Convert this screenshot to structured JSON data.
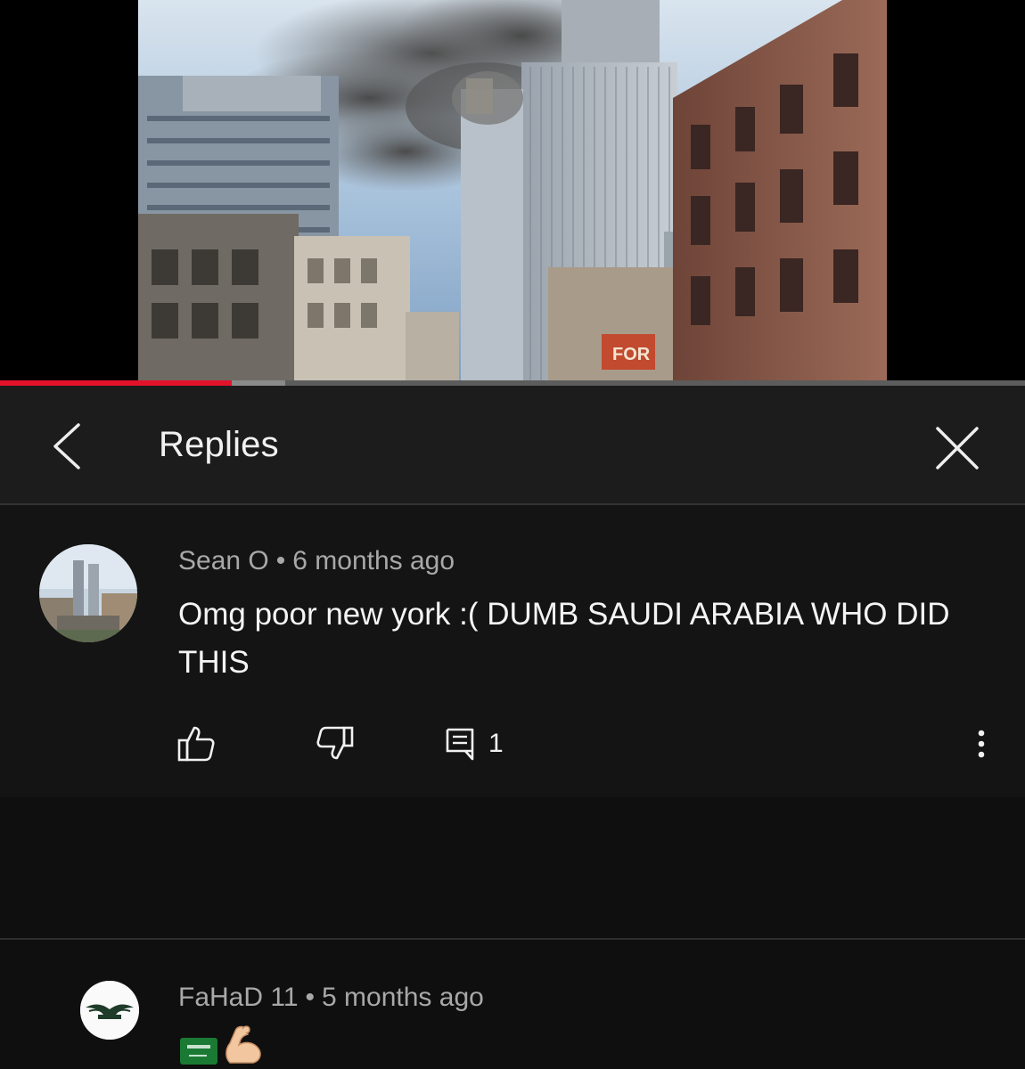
{
  "video": {
    "progress_played": 0.226,
    "progress_loaded": 0.278,
    "sign_text": "FOR"
  },
  "header": {
    "title": "Replies",
    "back_icon": "chevron-left-icon",
    "close_icon": "close-icon"
  },
  "comment": {
    "author": "Sean O",
    "separator": "•",
    "time": "6 months ago",
    "text": "Omg poor new york :( DUMB SAUDI ARABIA WHO DID THIS",
    "reply_count": "1",
    "icons": [
      "thumbs-up-icon",
      "thumbs-down-icon",
      "reply-icon",
      "more-vert-icon"
    ]
  },
  "reply": {
    "author": "FaHaD 11",
    "separator": "•",
    "time": "5 months ago",
    "emojis": [
      "saudi-flag-icon",
      "flexed-biceps-icon"
    ]
  },
  "colors": {
    "background": "#0f0f0f",
    "header_bg": "#1c1c1c",
    "comment_bg": "#141414",
    "progress_played": "#e3122b",
    "meta_text": "#a8a8a8",
    "primary_text": "#f1f1f1"
  }
}
